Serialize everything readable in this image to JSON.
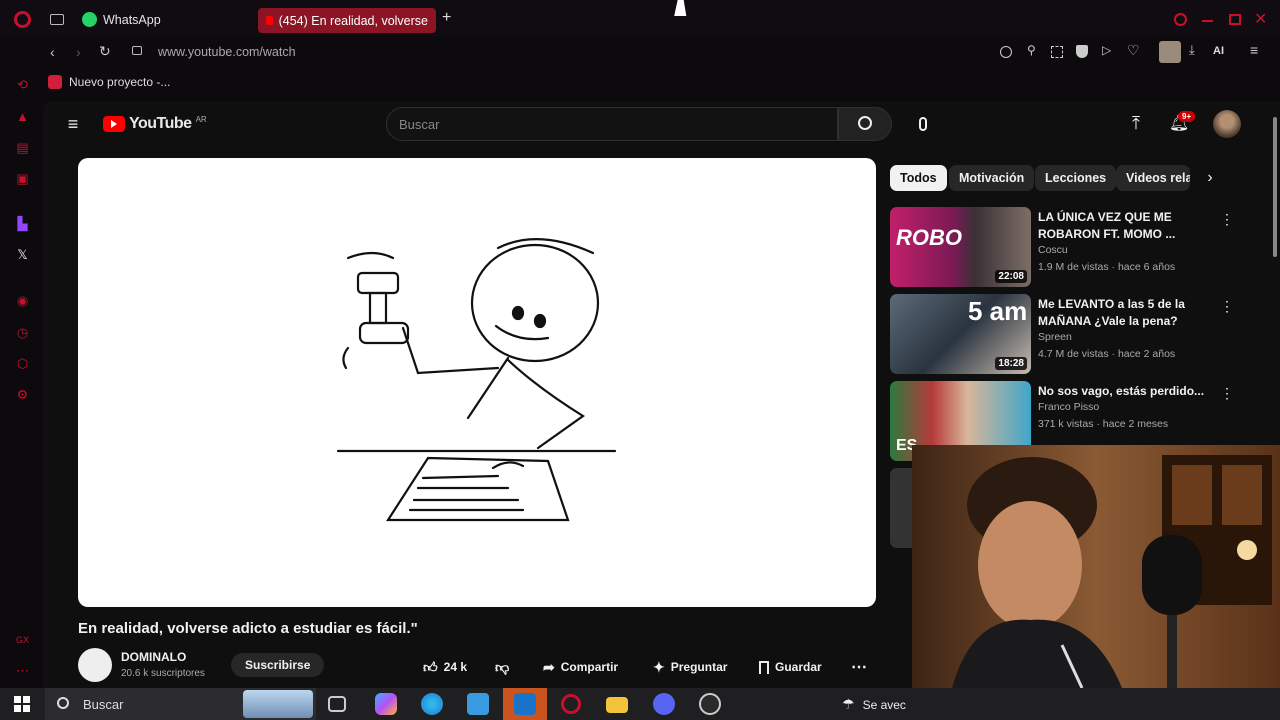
{
  "browser": {
    "tabs": [
      {
        "label": "WhatsApp"
      },
      {
        "label": "(454) En realidad, volverse"
      }
    ],
    "url": "www.youtube.com/watch",
    "ai_label": "AI",
    "bookmark": "Nuevo proyecto -..."
  },
  "youtube": {
    "logo_text": "YouTube",
    "region": "AR",
    "search_placeholder": "Buscar",
    "notif_badge": "9+",
    "video_title": "En realidad, volverse adicto a estudiar es fácil.\"",
    "channel": {
      "name": "DOMINALO",
      "subs": "20.6 k suscriptores"
    },
    "subscribe_label": "Suscribirse",
    "likes": "24 k",
    "actions": {
      "share": "Compartir",
      "ask": "Preguntar",
      "save": "Guardar"
    },
    "chips": [
      "Todos",
      "Motivación",
      "Lecciones",
      "Videos rela"
    ],
    "recommendations": [
      {
        "title": "LA ÚNICA VEZ QUE ME ROBARON FT. MOMO ...",
        "channel": "Coscu",
        "meta": "1.9 M de vistas · hace 6 años",
        "duration": "22:08",
        "thumb_text": "ROBO"
      },
      {
        "title": "Me LEVANTO a las 5 de la MAÑANA ¿Vale la pena?",
        "channel": "Spreen",
        "meta": "4.7 M de vistas · hace 2 años",
        "duration": "18:28",
        "thumb_text": "5 am"
      },
      {
        "title": "No sos vago, estás perdido...",
        "channel": "Franco Pisso",
        "meta": "371 k vistas · hace 2 meses",
        "duration": "",
        "thumb_text": "ES"
      }
    ]
  },
  "taskbar": {
    "search_placeholder": "Buscar",
    "weather_text": "Se avec"
  },
  "colors": {
    "accent": "#c8102e",
    "yt_red": "#ff0000",
    "bg": "#0f0f0f"
  }
}
